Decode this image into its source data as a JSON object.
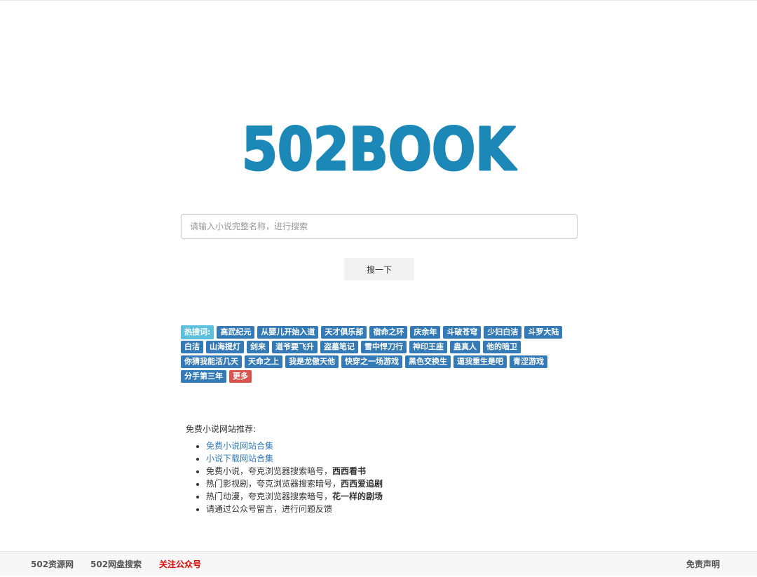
{
  "logo": {
    "text": "502BOOK",
    "color": "#1b88b7"
  },
  "search": {
    "placeholder": "请输入小说完整名称，进行搜索",
    "value": "",
    "button_label": "搜一下"
  },
  "hot": {
    "label": "热搜词:",
    "tags": [
      "高武纪元",
      "从婴儿开始入道",
      "天才俱乐部",
      "宿命之环",
      "庆余年",
      "斗破苍穹",
      "少妇白洁",
      "斗罗大陆",
      "白洁",
      "山海提灯",
      "剑来",
      "道爷要飞升",
      "盗墓笔记",
      "雪中悍刀行",
      "神印王座",
      "蛊真人",
      "他的暗卫",
      "你猜我能活几天",
      "天命之上",
      "我是龙傲天他",
      "快穿之一场游戏",
      "黑色交换生",
      "逼我重生是吧",
      "青涩游戏",
      "分手第三年"
    ],
    "more_label": "更多",
    "tag_color": "#337ab7",
    "label_color": "#5bc0de",
    "more_color": "#d9534f"
  },
  "recommend": {
    "title": "免费小说网站推荐:",
    "link1": "免费小说网站合集",
    "link2": "小说下载网站合集",
    "item3_text": "免费小说，夸克浏览器搜索暗号，",
    "item3_bold": "西西看书",
    "item4_text": "热门影视剧，夸克浏览器搜索暗号，",
    "item4_bold": "西西爱追剧",
    "item5_text": "热门动漫，夸克浏览器搜索暗号，",
    "item5_bold": "花一样的剧场",
    "item6_text": "请通过公众号留言，进行问题反馈"
  },
  "footer": {
    "link1": "502资源网",
    "link2": "502网盘搜索",
    "link3": "关注公众号",
    "link4": "免责声明",
    "highlight_color": "#e00000"
  }
}
